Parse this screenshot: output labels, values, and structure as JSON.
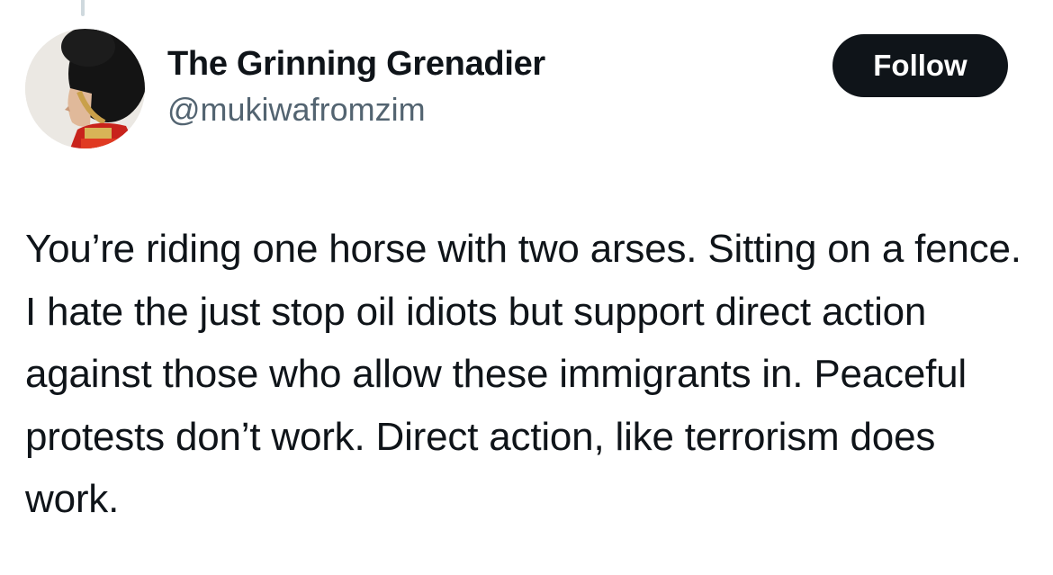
{
  "colors": {
    "text_primary": "#0f1419",
    "text_secondary": "#536471",
    "follow_button_bg": "#0f1419",
    "follow_button_text": "#ffffff",
    "background": "#ffffff"
  },
  "author": {
    "display_name": "The Grinning Grenadier",
    "handle": "@mukiwafromzim",
    "avatar_icon": "grenadier-guard-avatar"
  },
  "actions": {
    "follow_label": "Follow"
  },
  "tweet": {
    "text": "You’re riding one horse with two arses. Sitting on a fence. I hate the just stop oil idiots but support direct action against those who allow these immigrants in. Peaceful protests don’t work. Direct action, like terrorism does work."
  }
}
